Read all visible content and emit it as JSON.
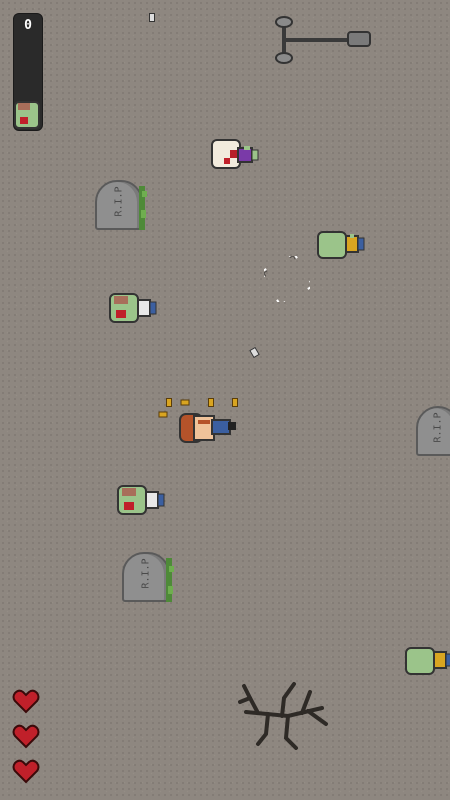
{
  "hud": {
    "kill_count": "0",
    "kill_progress": 0.1,
    "lives": 3,
    "kill_icon": "zombie-head-icon",
    "life_icon": "heart-icon"
  },
  "colors": {
    "ground": "#8e8780",
    "zombie_skin": "#9bc48a",
    "player_hair": "#b5532a",
    "heart": "#c0202a",
    "bullet": "#d9a521",
    "counter_bg": "#2a2a2a"
  },
  "tombstones": [
    {
      "label": "R.I.P"
    },
    {
      "label": "R.I.P"
    },
    {
      "label": "R.I.P"
    }
  ],
  "props": [
    "lamp-post-icon",
    "dead-tree-icon",
    "crosshair-icon"
  ]
}
